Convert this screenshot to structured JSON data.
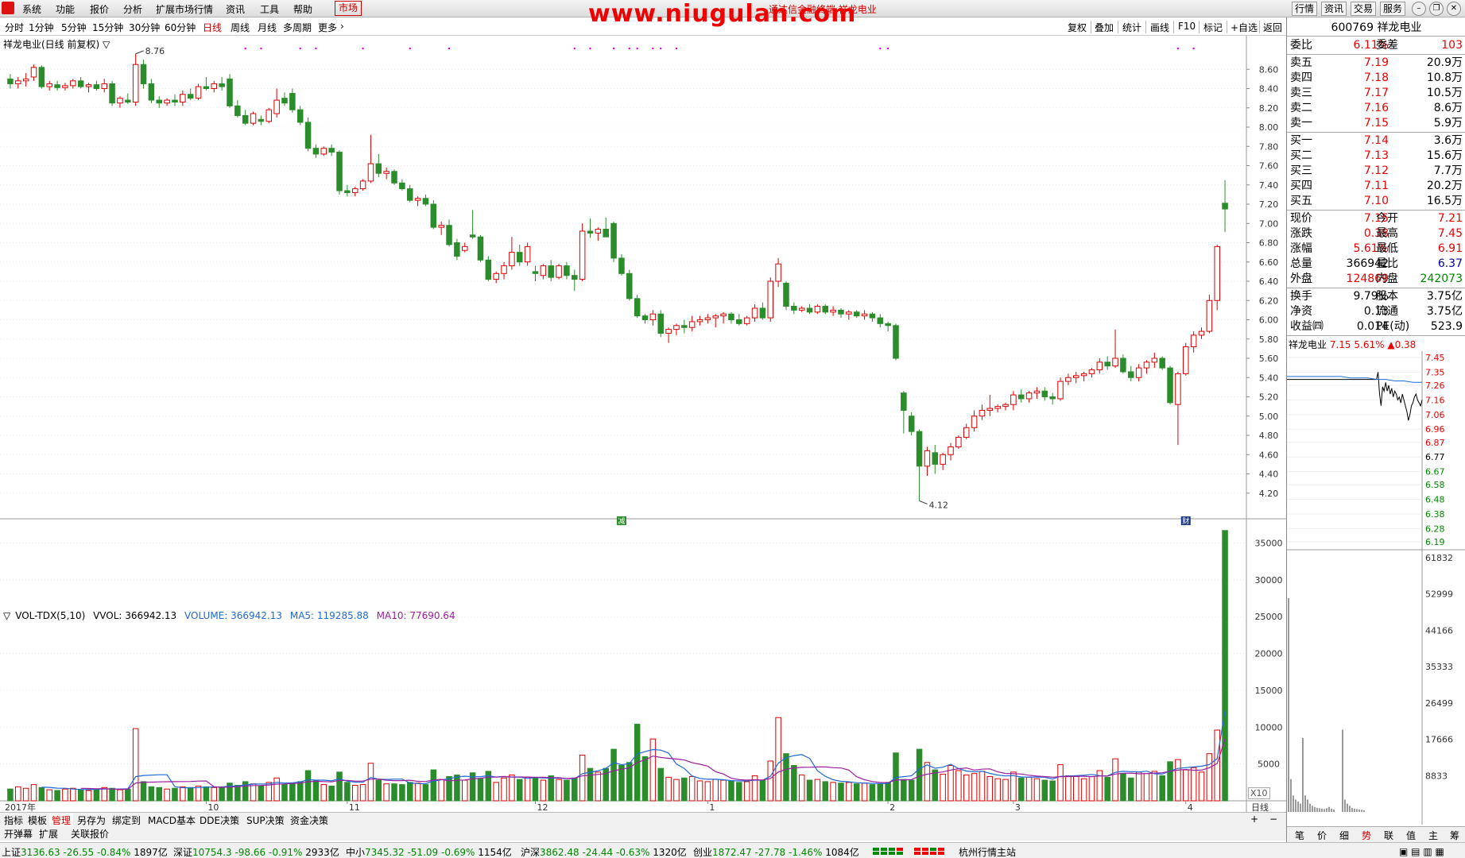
{
  "menu": {
    "items": [
      "系统",
      "功能",
      "报价",
      "分析",
      "扩展市场行情",
      "资讯",
      "工具",
      "帮助"
    ],
    "market": "市场",
    "title": "通达信金融终端 祥龙电业",
    "watermark": "www.niugulan.com",
    "right_buttons": [
      "行情",
      "资讯",
      "交易",
      "服务"
    ]
  },
  "periods": [
    "分时",
    "1分钟",
    "5分钟",
    "15分钟",
    "30分钟",
    "60分钟",
    "日线",
    "周线",
    "月线",
    "多周期",
    "更多"
  ],
  "active_period": "日线",
  "tools": [
    "复权",
    "叠加",
    "统计",
    "画线",
    "F10",
    "标记",
    "+自选",
    "返回"
  ],
  "chart_title": "祥龙电业(日线 前复权)",
  "price_markers": {
    "high": "8.76",
    "low": "4.12"
  },
  "badges": {
    "first": "减",
    "second": "财"
  },
  "volume_legend": {
    "name": "VOL-TDX(5,10)",
    "vvol": "VVOL: 366942.13",
    "volume": "VOLUME: 366942.13",
    "ma5": "MA5: 119285.88",
    "ma10": "MA10: 77690.64"
  },
  "x10_label": "X10",
  "date_axis": [
    "2017年",
    "10",
    "11",
    "12",
    "1",
    "2",
    "3",
    "4"
  ],
  "bottom_tabs": [
    "指标",
    "模板",
    "管理",
    "另存为",
    "绑定到",
    "MACD基本",
    "DDE决策",
    "SUP决策",
    "资金决策"
  ],
  "bottom_tabs2": [
    "开弹幕",
    "扩展",
    "关联报价"
  ],
  "status": {
    "sh": {
      "name": "上证",
      "value": "3136.63",
      "chg": "-26.55",
      "pct": "-0.84%",
      "amt": "1897亿"
    },
    "sz": {
      "name": "深证",
      "value": "10754.3",
      "chg": "-98.66",
      "pct": "-0.91%",
      "amt": "2933亿"
    },
    "zx": {
      "name": "中小",
      "value": "7345.32",
      "chg": "-51.09",
      "pct": "-0.69%",
      "amt": "1154亿"
    },
    "hs": {
      "name": "沪深",
      "value": "3862.48",
      "chg": "-24.44",
      "pct": "-0.63%",
      "amt": "1320亿"
    },
    "cy": {
      "name": "创业",
      "value": "1872.47",
      "chg": "-27.78",
      "pct": "-1.46%",
      "amt": "1084亿"
    },
    "station": "杭州行情主站"
  },
  "quote": {
    "code_name": "600769 祥龙电业",
    "weibi_label": "委比",
    "weibi": "6.11%",
    "weicha_label": "委差",
    "weicha": "103",
    "asks": [
      {
        "label": "卖五",
        "price": "7.19",
        "vol": "20.9万"
      },
      {
        "label": "卖四",
        "price": "7.18",
        "vol": "10.8万"
      },
      {
        "label": "卖三",
        "price": "7.17",
        "vol": "10.5万"
      },
      {
        "label": "卖二",
        "price": "7.16",
        "vol": "8.6万"
      },
      {
        "label": "卖一",
        "price": "7.15",
        "vol": "5.9万"
      }
    ],
    "bids": [
      {
        "label": "买一",
        "price": "7.14",
        "vol": "3.6万"
      },
      {
        "label": "买二",
        "price": "7.13",
        "vol": "15.6万"
      },
      {
        "label": "买三",
        "price": "7.12",
        "vol": "7.7万"
      },
      {
        "label": "买四",
        "price": "7.11",
        "vol": "20.2万"
      },
      {
        "label": "买五",
        "price": "7.10",
        "vol": "16.5万"
      }
    ],
    "stats": [
      {
        "l1": "现价",
        "v1": "7.15",
        "c1": "up",
        "l2": "今开",
        "v2": "7.21",
        "c2": "up"
      },
      {
        "l1": "涨跌",
        "v1": "0.38",
        "c1": "up",
        "l2": "最高",
        "v2": "7.45",
        "c2": "up"
      },
      {
        "l1": "涨幅",
        "v1": "5.61%",
        "c1": "up",
        "l2": "最低",
        "v2": "6.91",
        "c2": "up"
      },
      {
        "l1": "总量",
        "v1": "366942",
        "c1": "",
        "l2": "量比",
        "v2": "6.37",
        "c2": "blue"
      },
      {
        "l1": "外盘",
        "v1": "124869",
        "c1": "up",
        "l2": "内盘",
        "v2": "242073",
        "c2": "dn"
      }
    ],
    "stats2": [
      {
        "l1": "换手",
        "v1": "9.79%",
        "l2": "股本",
        "v2": "3.75亿"
      },
      {
        "l1": "净资",
        "v1": "0.13",
        "l2": "流通",
        "v2": "3.75亿"
      },
      {
        "l1": "收益㈣",
        "v1": "0.014",
        "l2": "PE(动)",
        "v2": "523.9"
      }
    ],
    "mini": {
      "name": "祥龙电业",
      "price": "7.15",
      "pct": "5.61%",
      "chg": "▲0.38"
    },
    "mini_price_ticks": [
      "7.45",
      "7.35",
      "7.26",
      "7.16",
      "7.06",
      "6.96",
      "6.87",
      "6.77",
      "6.67",
      "6.58",
      "6.48",
      "6.38",
      "6.28",
      "6.19"
    ],
    "mini_vol_ticks": [
      "61832",
      "52999",
      "44166",
      "35333",
      "26499",
      "17666",
      "8833"
    ],
    "tabs": [
      "笔",
      "价",
      "细",
      "势",
      "联",
      "值",
      "主",
      "筹"
    ],
    "active_tab": "势"
  },
  "chart_data": {
    "type": "candlestick",
    "title": "祥龙电业(日线 前复权)",
    "price_ylim": [
      4.0,
      8.8
    ],
    "price_ticks": [
      "8.60",
      "8.40",
      "8.20",
      "8.00",
      "7.80",
      "7.60",
      "7.40",
      "7.20",
      "7.00",
      "6.80",
      "6.60",
      "6.40",
      "6.20",
      "6.00",
      "5.80",
      "5.60",
      "5.40",
      "5.20",
      "5.00",
      "4.80",
      "4.60",
      "4.40",
      "4.20"
    ],
    "volume_ylim": [
      0,
      37000
    ],
    "volume_ticks": [
      "35000",
      "30000",
      "25000",
      "20000",
      "15000",
      "10000",
      "5000"
    ],
    "candles_ohlc": [
      [
        8.5,
        8.55,
        8.4,
        8.45
      ],
      [
        8.45,
        8.52,
        8.4,
        8.48
      ],
      [
        8.48,
        8.56,
        8.42,
        8.5
      ],
      [
        8.52,
        8.65,
        8.48,
        8.62
      ],
      [
        8.62,
        8.64,
        8.4,
        8.42
      ],
      [
        8.42,
        8.48,
        8.38,
        8.45
      ],
      [
        8.44,
        8.48,
        8.38,
        8.41
      ],
      [
        8.41,
        8.46,
        8.38,
        8.43
      ],
      [
        8.43,
        8.5,
        8.4,
        8.48
      ],
      [
        8.48,
        8.52,
        8.4,
        8.42
      ],
      [
        8.42,
        8.46,
        8.36,
        8.44
      ],
      [
        8.44,
        8.48,
        8.38,
        8.4
      ],
      [
        8.4,
        8.5,
        8.36,
        8.45
      ],
      [
        8.45,
        8.48,
        8.22,
        8.25
      ],
      [
        8.25,
        8.32,
        8.2,
        8.3
      ],
      [
        8.28,
        8.35,
        8.24,
        8.26
      ],
      [
        8.26,
        8.76,
        8.22,
        8.65
      ],
      [
        8.65,
        8.7,
        8.4,
        8.45
      ],
      [
        8.45,
        8.5,
        8.25,
        8.28
      ],
      [
        8.28,
        8.32,
        8.2,
        8.25
      ],
      [
        8.25,
        8.3,
        8.22,
        8.28
      ],
      [
        8.28,
        8.34,
        8.22,
        8.26
      ],
      [
        8.26,
        8.38,
        8.22,
        8.34
      ],
      [
        8.34,
        8.4,
        8.28,
        8.3
      ],
      [
        8.3,
        8.45,
        8.28,
        8.42
      ],
      [
        8.42,
        8.52,
        8.38,
        8.4
      ],
      [
        8.4,
        8.48,
        8.36,
        8.45
      ],
      [
        8.45,
        8.52,
        8.38,
        8.42
      ],
      [
        8.5,
        8.55,
        8.2,
        8.22
      ],
      [
        8.22,
        8.28,
        8.1,
        8.12
      ],
      [
        8.12,
        8.18,
        8.02,
        8.04
      ],
      [
        8.04,
        8.16,
        8.02,
        8.14
      ],
      [
        8.08,
        8.12,
        8.02,
        8.06
      ],
      [
        8.06,
        8.2,
        8.04,
        8.18
      ],
      [
        8.14,
        8.4,
        8.1,
        8.28
      ],
      [
        8.3,
        8.36,
        8.22,
        8.25
      ],
      [
        8.35,
        8.4,
        8.15,
        8.18
      ],
      [
        8.18,
        8.22,
        8.02,
        8.05
      ],
      [
        8.05,
        8.1,
        7.75,
        7.78
      ],
      [
        7.78,
        7.82,
        7.68,
        7.72
      ],
      [
        7.72,
        7.8,
        7.7,
        7.78
      ],
      [
        7.78,
        7.82,
        7.7,
        7.74
      ],
      [
        7.74,
        7.76,
        7.3,
        7.34
      ],
      [
        7.34,
        7.4,
        7.28,
        7.32
      ],
      [
        7.32,
        7.38,
        7.28,
        7.36
      ],
      [
        7.36,
        7.46,
        7.34,
        7.44
      ],
      [
        7.44,
        7.92,
        7.42,
        7.62
      ],
      [
        7.62,
        7.72,
        7.48,
        7.52
      ],
      [
        7.52,
        7.58,
        7.46,
        7.54
      ],
      [
        7.54,
        7.56,
        7.4,
        7.42
      ],
      [
        7.42,
        7.46,
        7.34,
        7.36
      ],
      [
        7.36,
        7.4,
        7.22,
        7.24
      ],
      [
        7.24,
        7.28,
        7.18,
        7.26
      ],
      [
        7.26,
        7.3,
        7.18,
        7.2
      ],
      [
        7.2,
        7.24,
        6.94,
        6.96
      ],
      [
        6.96,
        7.02,
        6.88,
        6.98
      ],
      [
        6.98,
        7.04,
        6.76,
        6.78
      ],
      [
        6.8,
        6.84,
        6.62,
        6.66
      ],
      [
        6.72,
        6.8,
        6.7,
        6.76
      ],
      [
        6.88,
        7.14,
        6.84,
        6.86
      ],
      [
        6.86,
        6.88,
        6.6,
        6.62
      ],
      [
        6.62,
        6.66,
        6.4,
        6.42
      ],
      [
        6.42,
        6.5,
        6.38,
        6.48
      ],
      [
        6.48,
        6.6,
        6.42,
        6.56
      ],
      [
        6.56,
        6.86,
        6.52,
        6.7
      ],
      [
        6.7,
        6.78,
        6.56,
        6.6
      ],
      [
        6.6,
        6.8,
        6.56,
        6.76
      ],
      [
        6.5,
        6.56,
        6.4,
        6.48
      ],
      [
        6.46,
        6.58,
        6.42,
        6.56
      ],
      [
        6.56,
        6.62,
        6.4,
        6.44
      ],
      [
        6.44,
        6.58,
        6.42,
        6.56
      ],
      [
        6.56,
        6.6,
        6.42,
        6.46
      ],
      [
        6.46,
        6.52,
        6.3,
        6.42
      ],
      [
        6.42,
        7.0,
        6.4,
        6.92
      ],
      [
        6.92,
        7.05,
        6.85,
        6.9
      ],
      [
        6.9,
        6.96,
        6.82,
        6.94
      ],
      [
        6.94,
        7.06,
        6.88,
        6.86
      ],
      [
        7.0,
        7.02,
        6.6,
        6.64
      ],
      [
        6.64,
        6.68,
        6.46,
        6.48
      ],
      [
        6.48,
        6.52,
        6.2,
        6.22
      ],
      [
        6.22,
        6.26,
        6.02,
        6.04
      ],
      [
        6.04,
        6.06,
        5.96,
        6.0
      ],
      [
        6.0,
        6.1,
        5.94,
        6.06
      ],
      [
        6.06,
        6.1,
        5.82,
        5.86
      ],
      [
        5.86,
        5.92,
        5.76,
        5.9
      ],
      [
        5.9,
        5.96,
        5.84,
        5.94
      ],
      [
        5.94,
        6.0,
        5.86,
        5.92
      ],
      [
        5.92,
        6.04,
        5.88,
        5.98
      ],
      [
        5.98,
        6.04,
        5.94,
        6.0
      ],
      [
        6.0,
        6.06,
        5.96,
        6.02
      ],
      [
        6.02,
        6.06,
        5.92,
        6.04
      ],
      [
        6.04,
        6.08,
        5.96,
        6.06
      ],
      [
        6.06,
        6.08,
        5.96,
        6.0
      ],
      [
        6.0,
        6.06,
        5.94,
        5.96
      ],
      [
        5.96,
        6.04,
        5.94,
        6.02
      ],
      [
        6.02,
        6.16,
        5.98,
        6.12
      ],
      [
        6.12,
        6.18,
        6.0,
        6.02
      ],
      [
        6.02,
        6.44,
        5.98,
        6.4
      ],
      [
        6.4,
        6.64,
        6.34,
        6.58
      ],
      [
        6.38,
        6.4,
        6.1,
        6.14
      ],
      [
        6.14,
        6.18,
        6.06,
        6.1
      ],
      [
        6.1,
        6.14,
        6.08,
        6.12
      ],
      [
        6.12,
        6.16,
        6.06,
        6.08
      ],
      [
        6.08,
        6.16,
        6.06,
        6.14
      ],
      [
        6.14,
        6.16,
        6.06,
        6.08
      ],
      [
        6.08,
        6.14,
        6.04,
        6.1
      ],
      [
        6.1,
        6.12,
        6.02,
        6.06
      ],
      [
        6.06,
        6.1,
        6.0,
        6.08
      ],
      [
        6.08,
        6.1,
        6.02,
        6.04
      ],
      [
        6.04,
        6.1,
        6.0,
        6.06
      ],
      [
        6.06,
        6.08,
        5.98,
        6.02
      ],
      [
        6.02,
        6.06,
        5.92,
        5.96
      ],
      [
        5.96,
        5.98,
        5.88,
        5.94
      ],
      [
        5.94,
        5.96,
        5.58,
        5.6
      ],
      [
        5.24,
        5.26,
        4.82,
        5.06
      ],
      [
        5.0,
        5.04,
        4.8,
        4.84
      ],
      [
        4.84,
        4.86,
        4.12,
        4.48
      ],
      [
        4.48,
        4.68,
        4.38,
        4.64
      ],
      [
        4.62,
        4.7,
        4.4,
        4.5
      ],
      [
        4.5,
        4.62,
        4.44,
        4.6
      ],
      [
        4.6,
        4.72,
        4.54,
        4.68
      ],
      [
        4.68,
        4.8,
        4.66,
        4.78
      ],
      [
        4.78,
        4.92,
        4.76,
        4.88
      ],
      [
        4.88,
        5.06,
        4.84,
        5.0
      ],
      [
        5.0,
        5.12,
        4.96,
        5.06
      ],
      [
        5.06,
        5.22,
        5.0,
        5.08
      ],
      [
        5.08,
        5.12,
        5.04,
        5.1
      ],
      [
        5.1,
        5.14,
        5.06,
        5.12
      ],
      [
        5.12,
        5.26,
        5.06,
        5.22
      ],
      [
        5.22,
        5.28,
        5.14,
        5.18
      ],
      [
        5.18,
        5.26,
        5.14,
        5.24
      ],
      [
        5.24,
        5.3,
        5.18,
        5.26
      ],
      [
        5.26,
        5.3,
        5.16,
        5.2
      ],
      [
        5.2,
        5.24,
        5.12,
        5.18
      ],
      [
        5.18,
        5.4,
        5.16,
        5.36
      ],
      [
        5.36,
        5.44,
        5.32,
        5.4
      ],
      [
        5.4,
        5.46,
        5.34,
        5.42
      ],
      [
        5.42,
        5.46,
        5.36,
        5.44
      ],
      [
        5.44,
        5.5,
        5.4,
        5.48
      ],
      [
        5.48,
        5.6,
        5.44,
        5.56
      ],
      [
        5.56,
        5.62,
        5.48,
        5.52
      ],
      [
        5.52,
        5.9,
        5.5,
        5.6
      ],
      [
        5.6,
        5.64,
        5.44,
        5.46
      ],
      [
        5.46,
        5.52,
        5.36,
        5.4
      ],
      [
        5.4,
        5.54,
        5.36,
        5.5
      ],
      [
        5.5,
        5.58,
        5.44,
        5.56
      ],
      [
        5.56,
        5.66,
        5.5,
        5.6
      ],
      [
        5.6,
        5.62,
        5.48,
        5.5
      ],
      [
        5.5,
        5.52,
        5.12,
        5.14
      ],
      [
        5.12,
        5.46,
        4.7,
        5.44
      ],
      [
        5.44,
        5.76,
        5.42,
        5.72
      ],
      [
        5.72,
        5.88,
        5.66,
        5.84
      ],
      [
        5.84,
        5.92,
        5.8,
        5.88
      ],
      [
        5.88,
        6.26,
        5.86,
        6.2
      ],
      [
        6.2,
        6.78,
        6.1,
        6.76
      ],
      [
        7.21,
        7.45,
        6.91,
        7.15
      ]
    ],
    "volumes": [
      1600,
      1900,
      1700,
      2200,
      1800,
      1500,
      1400,
      1600,
      1700,
      1500,
      1400,
      1600,
      1800,
      1700,
      1500,
      1600,
      9800,
      2600,
      1900,
      1800,
      1600,
      1700,
      1900,
      1800,
      2000,
      1900,
      1800,
      1900,
      2400,
      2100,
      2600,
      2300,
      2000,
      2500,
      3100,
      2200,
      2400,
      2600,
      4100,
      2700,
      2200,
      2000,
      3900,
      2500,
      2100,
      2200,
      5100,
      2800,
      2300,
      2300,
      2200,
      2500,
      2400,
      2200,
      4200,
      2900,
      3300,
      3500,
      2800,
      3800,
      3000,
      4000,
      2500,
      3100,
      3500,
      2900,
      3200,
      3100,
      2800,
      3400,
      2900,
      2800,
      3100,
      6200,
      4400,
      3900,
      4400,
      7000,
      4800,
      5200,
      10400,
      6000,
      8400,
      4400,
      3200,
      2900,
      3100,
      3300,
      2700,
      2600,
      2900,
      2800,
      2700,
      2500,
      2600,
      3400,
      2800,
      5400,
      11300,
      6400,
      4800,
      3500,
      2800,
      2900,
      2600,
      2500,
      2400,
      2500,
      2300,
      2400,
      2200,
      2300,
      2500,
      6500,
      2900,
      2800,
      7000,
      5200,
      4200,
      3600,
      4800,
      4100,
      3500,
      3700,
      4000,
      3300,
      3000,
      2900,
      3900,
      3100,
      3200,
      3000,
      2800,
      2700,
      4900,
      3400,
      3300,
      3000,
      3300,
      4100,
      3200,
      5700,
      3700,
      3100,
      3900,
      3700,
      4000,
      3400,
      5300,
      5600,
      4200,
      4500,
      3900,
      6400,
      9600,
      36700
    ],
    "ma5_color": "#1e6ad6",
    "ma10_color": "#9b1fa0",
    "up_color": "#e00000",
    "down_color": "#2a8c2a"
  }
}
